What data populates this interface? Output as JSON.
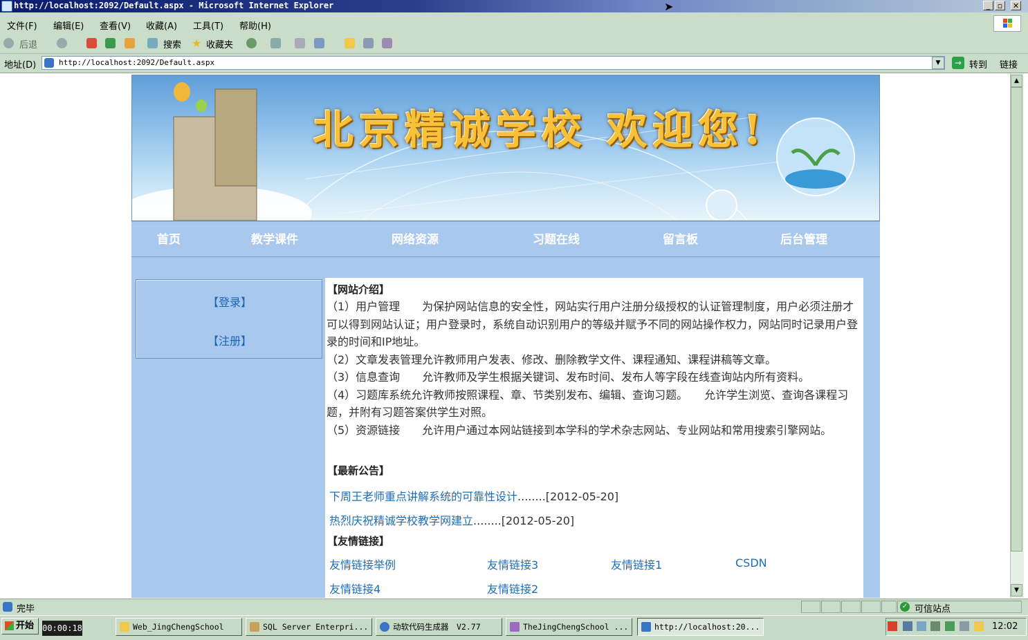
{
  "window": {
    "title": "http://localhost:2092/Default.aspx - Microsoft Internet Explorer"
  },
  "menu": [
    "文件(F)",
    "编辑(E)",
    "查看(V)",
    "收藏(A)",
    "工具(T)",
    "帮助(H)"
  ],
  "toolbar": {
    "back": "后退",
    "search": "搜索",
    "favorites": "收藏夹"
  },
  "address": {
    "label": "地址(D)",
    "url": "http://localhost:2092/Default.aspx",
    "go": "转到",
    "links": "链接"
  },
  "banner": {
    "title": "北京精诚学校 欢迎您!"
  },
  "nav": [
    "首页",
    "教学课件",
    "网络资源",
    "习题在线",
    "留言板",
    "后台管理"
  ],
  "login": {
    "login": "【登录】",
    "register": "【注册】"
  },
  "intro": {
    "heading": "【网站介绍】",
    "items": [
      "（1）用户管理　　为保护网站信息的安全性，网站实行用户注册分级授权的认证管理制度，用户必须注册才可以得到网站认证；用户登录时，系统自动识别用户的等级并赋予不同的网站操作权力，网站同时记录用户登录的时间和IP地址。",
      "（2）文章发表管理允许教师用户发表、修改、删除教学文件、课程通知、课程讲稿等文章。",
      "（3）信息查询　　允许教师及学生根据关键词、发布时间、发布人等字段在线查询站内所有资料。",
      "（4）习题库系统允许教师按照课程、章、节类别发布、编辑、查询习题。　　允许学生浏览、查询各课程习题，并附有习题答案供学生对照。",
      "（5）资源链接　　允许用户通过本网站链接到本学科的学术杂志网站、专业网站和常用搜索引擎网站。"
    ]
  },
  "news": {
    "heading": "【最新公告】",
    "items": [
      {
        "title": "下周王老师重点讲解系统的可靠性设计",
        "date": "........[2012-05-20]"
      },
      {
        "title": "热烈庆祝精诚学校教学网建立",
        "date": "........[2012-05-20]"
      }
    ]
  },
  "links": {
    "heading": "【友情链接】",
    "items": [
      "友情链接举例",
      "友情链接3",
      "友情链接1",
      "CSDN",
      "友情链接4",
      "友情链接2"
    ]
  },
  "status": {
    "text": "完毕",
    "zone": "可信站点"
  },
  "taskbar": {
    "start": "开始",
    "timer": "00:00:18",
    "tasks": [
      "Web_JingChengSchool",
      "SQL Server Enterpri...",
      "动软代码生成器　V2.77",
      "TheJingChengSchool ...",
      "http://localhost:20..."
    ],
    "clock": "12:02"
  }
}
